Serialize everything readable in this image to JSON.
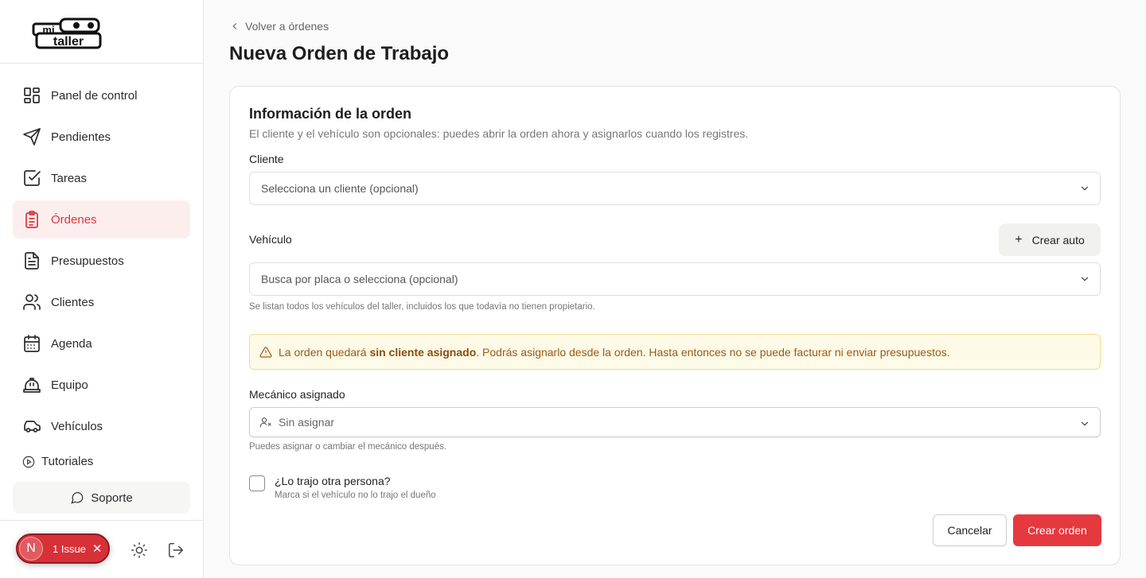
{
  "sidebar": {
    "logo_text": "mi taller",
    "items": [
      {
        "label": "Panel de control",
        "icon": "dashboard-icon"
      },
      {
        "label": "Pendientes",
        "icon": "send-icon"
      },
      {
        "label": "Tareas",
        "icon": "checkbox-icon"
      },
      {
        "label": "Órdenes",
        "icon": "clipboard-icon",
        "active": true
      },
      {
        "label": "Presupuestos",
        "icon": "document-icon"
      },
      {
        "label": "Clientes",
        "icon": "users-icon"
      },
      {
        "label": "Agenda",
        "icon": "calendar-icon"
      },
      {
        "label": "Equipo",
        "icon": "hardhat-icon"
      },
      {
        "label": "Vehículos",
        "icon": "car-icon"
      }
    ],
    "tutorials_label": "Tutoriales",
    "support_label": "Soporte",
    "issue": {
      "avatar": "N",
      "label": "1 Issue",
      "close": "✕"
    }
  },
  "header": {
    "back_label": "Volver a órdenes",
    "title": "Nueva Orden de Trabajo"
  },
  "form": {
    "title": "Información de la orden",
    "subtitle": "El cliente y el vehículo son opcionales: puedes abrir la orden ahora y asignarlos cuando los registres.",
    "client_label": "Cliente",
    "client_placeholder": "Selecciona un cliente (opcional)",
    "vehicle_label": "Vehículo",
    "create_auto_label": "Crear auto",
    "vehicle_placeholder": "Busca por placa o selecciona (opcional)",
    "vehicle_hint": "Se listan todos los vehículos del taller, incluidos los que todavía no tienen propietario.",
    "warning_prefix": "La orden quedará ",
    "warning_bold": "sin cliente asignado",
    "warning_suffix": ". Podrás asignarlo desde la orden. Hasta entonces no se puede facturar ni enviar presupuestos.",
    "mechanic_label": "Mecánico asignado",
    "mechanic_value": "Sin asignar",
    "mechanic_hint": "Puedes asignar o cambiar el mecánico después.",
    "other_person_label": "¿Lo trajo otra persona?",
    "other_person_hint": "Marca si el vehículo no lo trajo el dueño",
    "cancel_label": "Cancelar",
    "submit_label": "Crear orden"
  },
  "colors": {
    "accent": "#e5393f",
    "active_bg": "#fdeeee",
    "warning_bg": "#fefae8",
    "warning_text": "#9a5a12"
  }
}
